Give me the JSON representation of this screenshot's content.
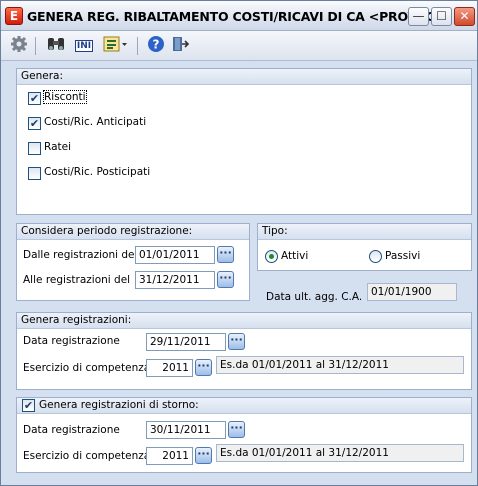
{
  "window": {
    "title": "GENERA REG. RIBALTAMENTO COSTI/RICAVI DI CA <PROVAC...",
    "app_icon_letter": "E",
    "minimize_glyph": "—",
    "maximize_glyph": "☐",
    "close_glyph": "✕"
  },
  "toolbar": {
    "settings_icon": "gear-icon",
    "find_icon": "binoculars-icon",
    "ini_label": "INI",
    "list_icon": "list-icon",
    "help_icon": "help-icon",
    "exit_icon": "exit-door-icon"
  },
  "genera": {
    "title": "Genera:",
    "options": [
      {
        "label": "Risconti",
        "checked": true
      },
      {
        "label": "Costi/Ric. Anticipati",
        "checked": true
      },
      {
        "label": "Ratei",
        "checked": false
      },
      {
        "label": "Costi/Ric. Posticipati",
        "checked": false
      }
    ]
  },
  "periodo": {
    "title": "Considera periodo registrazione:",
    "dalle_label": "Dalle registrazioni del",
    "dalle_value": "01/01/2011",
    "alle_label": "Alle registrazioni del",
    "alle_value": "31/12/2011"
  },
  "tipo": {
    "title": "Tipo:",
    "attivi_label": "Attivi",
    "passivi_label": "Passivi",
    "selected": "Attivi"
  },
  "data_ult": {
    "label": "Data ult. agg. C.A.",
    "value": "01/01/1900"
  },
  "genera_reg": {
    "title": "Genera registrazioni:",
    "data_label": "Data registrazione",
    "data_value": "29/11/2011",
    "esercizio_label": "Esercizio di competenza",
    "esercizio_value": "2011",
    "esercizio_desc": "Es.da 01/01/2011 al 31/12/2011"
  },
  "storno": {
    "title": "Genera registrazioni di storno:",
    "checked": true,
    "data_label": "Data registrazione",
    "data_value": "30/11/2011",
    "esercizio_label": "Esercizio di competenza",
    "esercizio_value": "2011",
    "esercizio_desc": "Es.da 01/01/2011 al 31/12/2011"
  },
  "ellipsis_glyph": "···",
  "check_glyph": "✔"
}
